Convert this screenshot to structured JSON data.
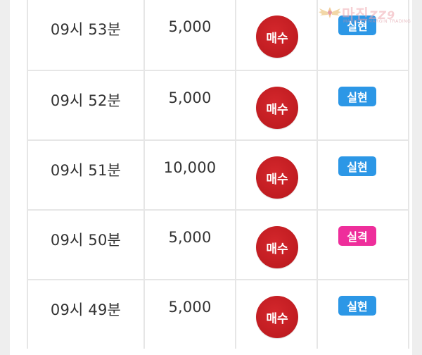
{
  "logo": {
    "text": "마진",
    "suffix": "ZZ9",
    "sub": "MAJINZZ9 MARGIN TRADING"
  },
  "rows": [
    {
      "time": "09시 53분",
      "amount": "5,000",
      "action": "매수",
      "result": "실현",
      "result_type": "win"
    },
    {
      "time": "09시 52분",
      "amount": "5,000",
      "action": "매수",
      "result": "실현",
      "result_type": "win"
    },
    {
      "time": "09시 51분",
      "amount": "10,000",
      "action": "매수",
      "result": "실현",
      "result_type": "win"
    },
    {
      "time": "09시 50분",
      "amount": "5,000",
      "action": "매수",
      "result": "실격",
      "result_type": "lose"
    },
    {
      "time": "09시 49분",
      "amount": "5,000",
      "action": "매수",
      "result": "실현",
      "result_type": "win"
    }
  ],
  "colors": {
    "buy": "#c81e23",
    "win": "#2c97e6",
    "lose": "#ee2e9b"
  }
}
